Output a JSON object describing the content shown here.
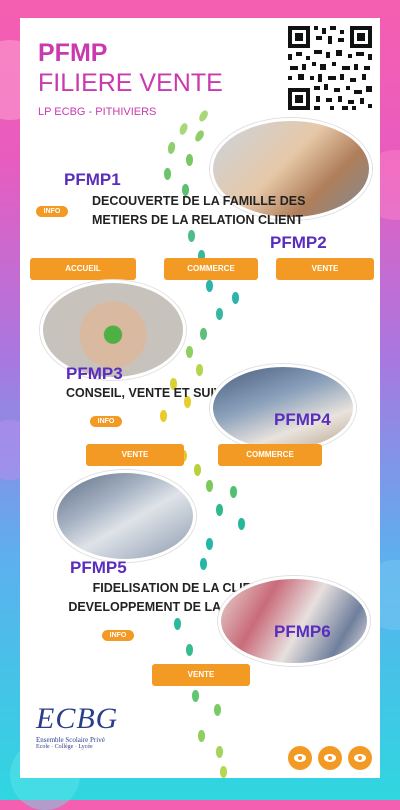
{
  "header": {
    "title_line1": "PFMP",
    "title_line2": "FILIERE VENTE",
    "subtitle": "LP ECBG - PITHIVIERS"
  },
  "qr": {
    "label": "qr-code"
  },
  "pfmp1": {
    "label": "PFMP1",
    "description": "DECOUVERTE DE LA FAMILLE DES METIERS DE LA RELATION CLIENT",
    "info": "INFO"
  },
  "pfmp2": {
    "label": "PFMP2"
  },
  "buttons_row1": [
    "ACCUEIL",
    "COMMERCE",
    "VENTE"
  ],
  "pfmp3": {
    "label": "PFMP3",
    "description": "CONSEIL, VENTE ET SUIVI DES VENTES",
    "info": "INFO"
  },
  "pfmp4": {
    "label": "PFMP4"
  },
  "buttons_row2": [
    "VENTE",
    "COMMERCE"
  ],
  "pfmp5": {
    "label": "PFMP5",
    "description": "FIDELISATION DE LA CLIENTELE ET DEVELOPPEMENT DE LA RELATION CLIENT",
    "info": "INFO"
  },
  "pfmp6": {
    "label": "PFMP6"
  },
  "buttons_row3": [
    "VENTE"
  ],
  "logo": {
    "brand": "ECBG",
    "line1": "Ensemble Scolaire Privé",
    "line2": "Ecole · Collège · Lycée"
  },
  "colors": {
    "accent": "#f39a24",
    "title": "#c93aae",
    "pfmp": "#5a2dbd"
  },
  "icons": [
    "eye-icon",
    "eye-icon",
    "eye-icon"
  ]
}
